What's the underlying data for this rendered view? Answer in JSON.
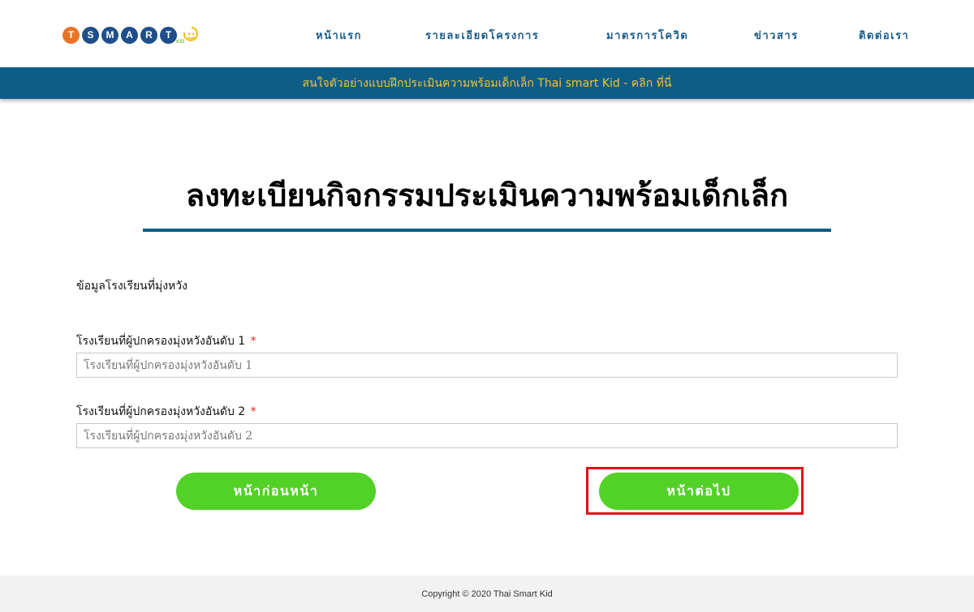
{
  "logo": {
    "letters": [
      "T",
      "S",
      "M",
      "A",
      "R",
      "T"
    ],
    "letter_colors": [
      "#e8742a",
      "#1f4f8a",
      "#1f4f8a",
      "#1f4f8a",
      "#1f4f8a",
      "#1f4f8a"
    ],
    "icon": "smiley-sun-icon",
    "suffix": "KID"
  },
  "nav": {
    "items": [
      "หน้าแรก",
      "รายละเอียดโครงการ",
      "มาตรการโควิด",
      "ข่าวสาร",
      "ติดต่อเรา"
    ]
  },
  "banner": {
    "text": "สนใจตัวอย่างแบบฝึกประเมินความพร้อมเด็กเล็ก Thai smart Kid - คลิก ที่นี่"
  },
  "page": {
    "title": "ลงทะเบียนกิจกรรมประเมินความพร้อมเด็กเล็ก",
    "section_label": "ข้อมูลโรงเรียนที่มุ่งหวัง"
  },
  "form": {
    "school1": {
      "label": "โรงเรียนที่ผู้ปกครองมุ่งหวังอันดับ 1",
      "required": "*",
      "placeholder": "โรงเรียนที่ผู้ปกครองมุ่งหวังอันดับ 1",
      "value": ""
    },
    "school2": {
      "label": "โรงเรียนที่ผู้ปกครองมุ่งหวังอันดับ 2",
      "required": "*",
      "placeholder": "โรงเรียนที่ผู้ปกครองมุ่งหวังอันดับ 2",
      "value": ""
    }
  },
  "buttons": {
    "prev": "หน้าก่อนหน้า",
    "next": "หน้าต่อไป"
  },
  "footer": {
    "copyright": "Copyright © 2020 Thai Smart Kid"
  },
  "colors": {
    "brand_blue": "#0d5d87",
    "banner_text": "#f4c430",
    "button_green": "#52d126",
    "highlight_red": "#e0101b"
  }
}
